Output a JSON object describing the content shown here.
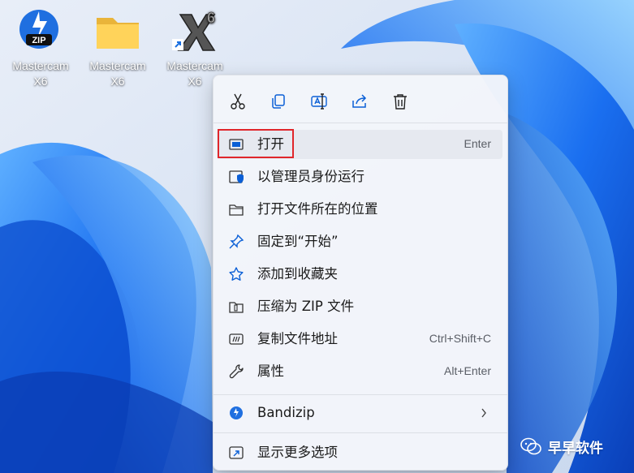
{
  "desktop": {
    "icons": [
      {
        "label": "Mastercam\nX6",
        "type": "zip-file"
      },
      {
        "label": "Mastercam\nX6",
        "type": "folder"
      },
      {
        "label": "Mastercam\nX6",
        "type": "mastercam-shortcut"
      }
    ]
  },
  "context_menu": {
    "quick_actions": [
      {
        "name": "cut",
        "icon": "scissors-icon"
      },
      {
        "name": "copy",
        "icon": "copy-icon"
      },
      {
        "name": "rename",
        "icon": "rename-icon"
      },
      {
        "name": "share",
        "icon": "share-icon"
      },
      {
        "name": "delete",
        "icon": "trash-icon"
      }
    ],
    "items": [
      {
        "label": "打开",
        "shortcut": "Enter",
        "icon": "open-window-icon"
      },
      {
        "label": "以管理员身份运行",
        "shortcut": "",
        "icon": "admin-shield-icon"
      },
      {
        "label": "打开文件所在的位置",
        "shortcut": "",
        "icon": "folder-open-icon"
      },
      {
        "label": "固定到“开始”",
        "shortcut": "",
        "icon": "pin-icon"
      },
      {
        "label": "添加到收藏夹",
        "shortcut": "",
        "icon": "star-icon"
      },
      {
        "label": "压缩为 ZIP 文件",
        "shortcut": "",
        "icon": "zip-archive-icon"
      },
      {
        "label": "复制文件地址",
        "shortcut": "Ctrl+Shift+C",
        "icon": "copy-path-icon"
      },
      {
        "label": "属性",
        "shortcut": "Alt+Enter",
        "icon": "wrench-icon"
      },
      {
        "label": "Bandizip",
        "shortcut": "",
        "icon": "bandizip-icon"
      },
      {
        "label": "显示更多选项",
        "shortcut": "",
        "icon": "more-options-icon"
      }
    ]
  },
  "watermark": {
    "text": "早早软件",
    "icon": "wechat-icon"
  },
  "colors": {
    "accent": "#0a5fd6",
    "highlight_border": "#e0262b"
  }
}
